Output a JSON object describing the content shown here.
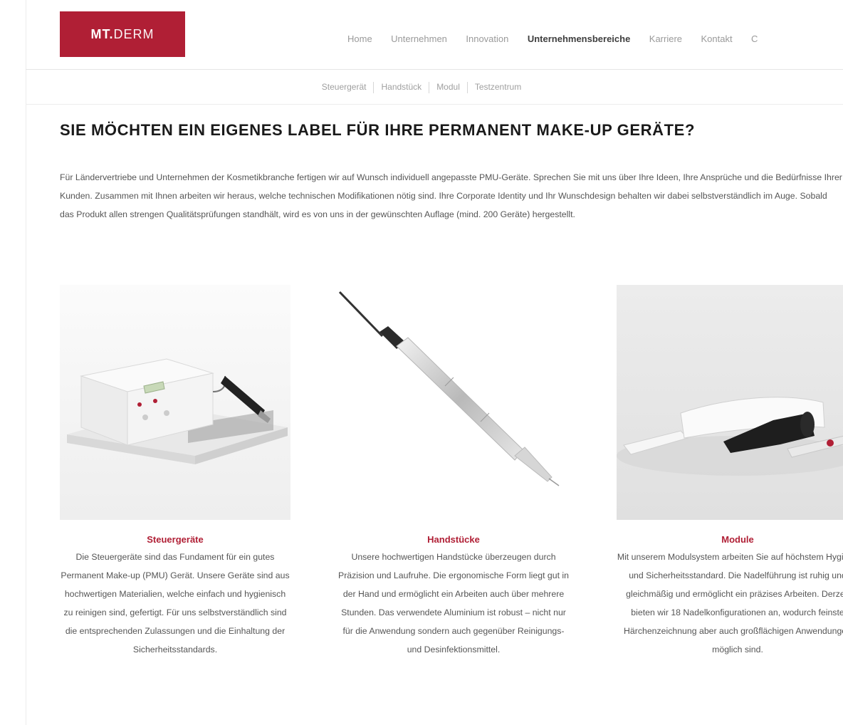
{
  "brand": {
    "logo_text_bold": "MT.",
    "logo_text_light": "DERM",
    "logo_color": "#b01f35"
  },
  "main_nav": {
    "items": [
      "Home",
      "Unternehmen",
      "Innovation",
      "Unternehmensbereiche",
      "Karriere",
      "Kontakt",
      "C"
    ],
    "active": "Unternehmensbereiche"
  },
  "sub_nav": {
    "items": [
      "Steuergerät",
      "Handstück",
      "Modul",
      "Testzentrum"
    ]
  },
  "page": {
    "title": "SIE MÖCHTEN EIN EIGENES LABEL FÜR IHRE PERMANENT MAKE-UP GERÄTE?",
    "intro": "Für Ländervertriebe und Unternehmen der Kosmetikbranche fertigen wir auf Wunsch individuell angepasste PMU-Geräte. Sprechen Sie mit uns über Ihre Ideen, Ihre Ansprüche und die Bedürfnisse Ihrer Kunden. Zusammen mit Ihnen arbeiten wir heraus, welche technischen Modifikationen nötig sind. Ihre Corporate Identity und Ihr Wunschdesign behalten wir dabei selbstverständlich im Auge. Sobald das Produkt allen strengen Qualitätsprüfungen standhält, wird es von uns in der gewünschten Auflage (mind. 200 Geräte) hergestellt."
  },
  "products": [
    {
      "title": "Steuergeräte",
      "text": "Die Steuergeräte sind das Fundament für ein gutes Permanent Make-up (PMU) Gerät. Unsere Geräte sind aus hochwertigen Materialien, welche einfach und hygienisch zu reinigen sind, gefertigt. Für uns selbstverständlich sind die entsprechenden Zulassungen und die Einhaltung der Sicherheitsstandards."
    },
    {
      "title": "Handstücke",
      "text": "Unsere hochwertigen Handstücke überzeugen durch Präzision und Laufruhe. Die ergonomische Form liegt gut in der Hand und ermöglicht ein Arbeiten auch über mehrere Stunden. Das verwendete Aluminium ist robust – nicht nur für die Anwendung sondern auch gegenüber Reinigungs- und Desinfektionsmittel."
    },
    {
      "title": "Module",
      "text": "Mit unserem Modulsystem arbeiten Sie auf höchstem Hygiene und Sicherheitsstandard. Die Nadelführung ist ruhig und gleichmäßig und ermöglicht ein präzises Arbeiten. Derzeit bieten wir 18 Nadelkonfigurationen an, wodurch feinste Härchenzeichnung aber auch großflächigen Anwendungen möglich sind."
    }
  ]
}
